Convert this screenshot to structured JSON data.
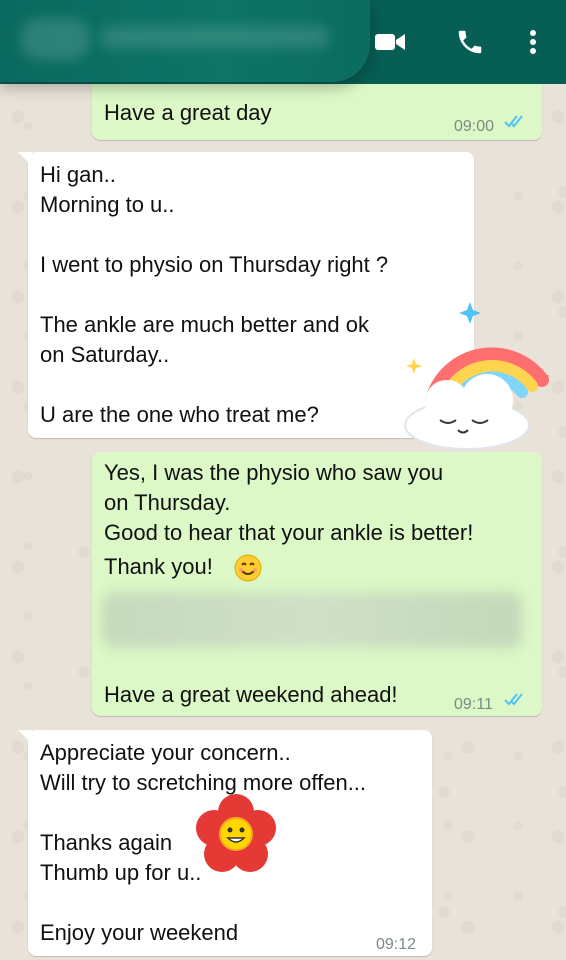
{
  "header": {
    "contact_name": "",
    "video_icon": "video-camera-icon",
    "call_icon": "phone-icon",
    "menu_icon": "more-vert-icon"
  },
  "messages": [
    {
      "direction": "outgoing",
      "lines": [
        "Have a great day"
      ],
      "time": "09:00",
      "status": "read"
    },
    {
      "direction": "incoming",
      "lines": [
        "Hi gan..",
        "Morning  to u..",
        "",
        "I went to physio on Thursday right ?",
        "",
        "The ankle are much better and ok",
        "on Saturday..",
        "",
        "U are the one who treat me?"
      ]
    },
    {
      "direction": "outgoing",
      "lines": [
        "Yes, I was the physio who saw you",
        "on Thursday.",
        "Good to hear that your ankle is better!",
        "Thank you!",
        "Have a great weekend ahead!"
      ],
      "time": "09:11",
      "status": "read"
    },
    {
      "direction": "incoming",
      "lines": [
        "Appreciate your concern..",
        "Will try to scretching more offen...",
        "",
        "Thanks again",
        "Thumb up for u..",
        "",
        "Enjoy your weekend"
      ],
      "time": "09:12"
    }
  ],
  "stickers": [
    "rainbow-cloud-sticker",
    "red-flower-smiley-sticker"
  ],
  "colors": {
    "header": "#075e54",
    "outgoing_bubble": "#dcf8c6",
    "incoming_bubble": "#ffffff",
    "read_ticks": "#4fc3f7"
  }
}
